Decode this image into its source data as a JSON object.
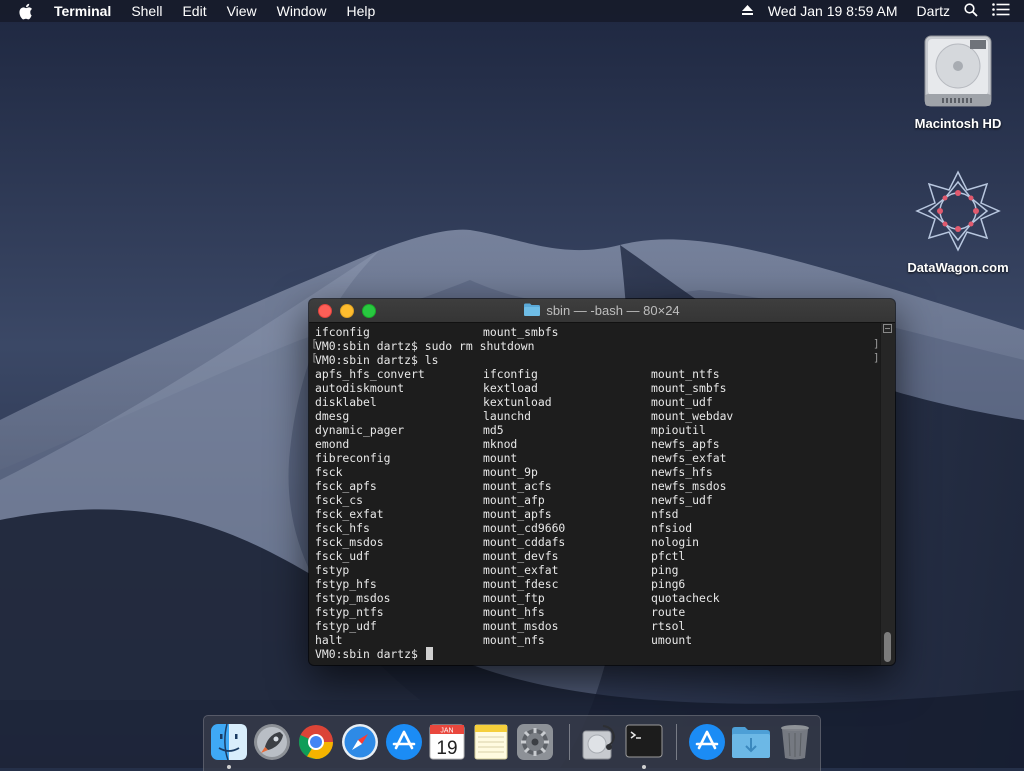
{
  "menubar": {
    "app_name": "Terminal",
    "items": [
      "Shell",
      "Edit",
      "View",
      "Window",
      "Help"
    ],
    "clock": "Wed Jan 19  8:59 AM",
    "user": "Dartz"
  },
  "desktop": {
    "icons": [
      {
        "label": "Macintosh HD",
        "icon": "hard-drive-icon"
      },
      {
        "label": "DataWagon.com",
        "icon": "datawagon-logo-icon"
      }
    ]
  },
  "terminal": {
    "title": "sbin — -bash — 80×24",
    "top_lines": [
      {
        "c1": "ifconfig",
        "c2": "mount_smbfs",
        "c3": ""
      },
      {
        "c1": "VM0:sbin dartz$ sudo rm shutdown",
        "c2": "",
        "c3": ""
      },
      {
        "c1": "VM0:sbin dartz$ ls",
        "c2": "",
        "c3": ""
      }
    ],
    "listing": [
      [
        "apfs_hfs_convert",
        "ifconfig",
        "mount_ntfs"
      ],
      [
        "autodiskmount",
        "kextload",
        "mount_smbfs"
      ],
      [
        "disklabel",
        "kextunload",
        "mount_udf"
      ],
      [
        "dmesg",
        "launchd",
        "mount_webdav"
      ],
      [
        "dynamic_pager",
        "md5",
        "mpioutil"
      ],
      [
        "emond",
        "mknod",
        "newfs_apfs"
      ],
      [
        "fibreconfig",
        "mount",
        "newfs_exfat"
      ],
      [
        "fsck",
        "mount_9p",
        "newfs_hfs"
      ],
      [
        "fsck_apfs",
        "mount_acfs",
        "newfs_msdos"
      ],
      [
        "fsck_cs",
        "mount_afp",
        "newfs_udf"
      ],
      [
        "fsck_exfat",
        "mount_apfs",
        "nfsd"
      ],
      [
        "fsck_hfs",
        "mount_cd9660",
        "nfsiod"
      ],
      [
        "fsck_msdos",
        "mount_cddafs",
        "nologin"
      ],
      [
        "fsck_udf",
        "mount_devfs",
        "pfctl"
      ],
      [
        "fstyp",
        "mount_exfat",
        "ping"
      ],
      [
        "fstyp_hfs",
        "mount_fdesc",
        "ping6"
      ],
      [
        "fstyp_msdos",
        "mount_ftp",
        "quotacheck"
      ],
      [
        "fstyp_ntfs",
        "mount_hfs",
        "route"
      ],
      [
        "fstyp_udf",
        "mount_msdos",
        "rtsol"
      ],
      [
        "halt",
        "mount_nfs",
        "umount"
      ]
    ],
    "prompt": "VM0:sbin dartz$ "
  },
  "dock": {
    "calendar_month": "JAN",
    "calendar_day": "19",
    "apps": [
      "Finder",
      "Launchpad",
      "Google Chrome",
      "Safari",
      "App Store",
      "Calendar",
      "Notes",
      "System Preferences",
      "Disk Utility",
      "Terminal",
      "App Store",
      "Downloads",
      "Trash"
    ]
  }
}
